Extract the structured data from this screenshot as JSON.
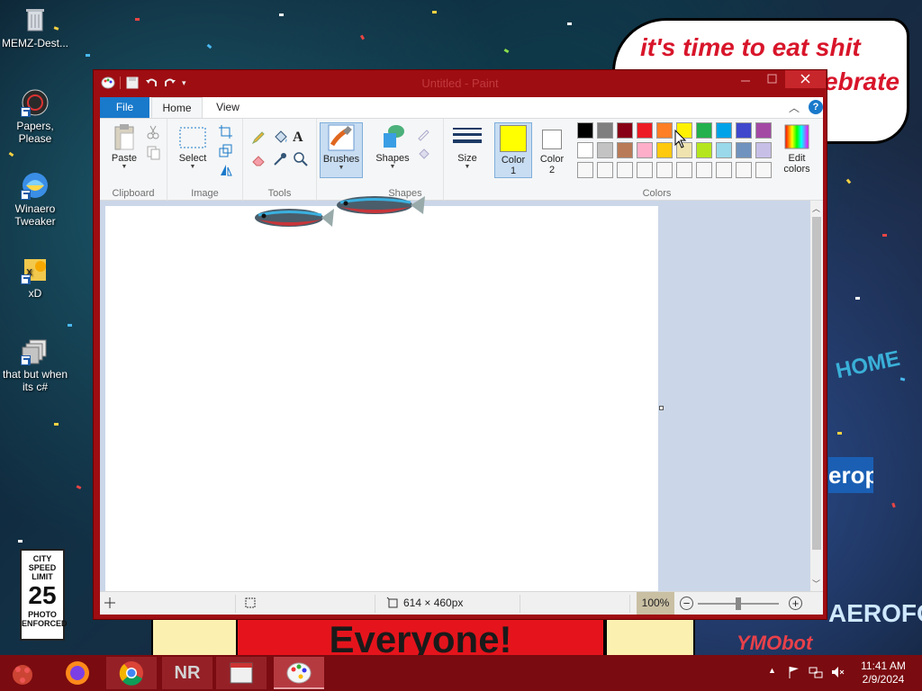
{
  "desktop": {
    "icons": [
      {
        "label": "MEMZ-Dest..."
      },
      {
        "label": "Papers, Please"
      },
      {
        "label": "Winaero Tweaker"
      },
      {
        "label": "xD"
      },
      {
        "label": "that but when its c#"
      }
    ],
    "bubble": {
      "line1": "it's time to eat shit",
      "line2": "ebrate"
    },
    "banner": "Everyone!",
    "sign": {
      "line1": "CITY",
      "line2": "SPEED",
      "line3": "LIMIT",
      "value": "25",
      "line4": "PHOTO",
      "line5": "ENFORCED"
    },
    "watermark": "YMObot",
    "building_sign": "AEROFOS",
    "building_sign2": "erop",
    "home_sign": "HOME"
  },
  "window": {
    "title": "Untitled - Paint",
    "tabs": {
      "file": "File",
      "home": "Home",
      "view": "View"
    },
    "help": "?",
    "ribbon": {
      "clipboard": {
        "label": "Clipboard",
        "paste": "Paste"
      },
      "image": {
        "label": "Image",
        "select": "Select"
      },
      "tools": {
        "label": "Tools",
        "text_glyph": "A"
      },
      "brushes": {
        "label": "Brushes"
      },
      "shapes": {
        "label": "Shapes",
        "group": "Shapes"
      },
      "size": {
        "label": "Size"
      },
      "color1": {
        "line1": "Color",
        "line2": "1",
        "value": "#ffff00"
      },
      "color2": {
        "line1": "Color",
        "line2": "2",
        "value": "#ffffff"
      },
      "colors": {
        "label": "Colors"
      },
      "edit_colors": {
        "line1": "Edit",
        "line2": "colors"
      }
    },
    "palette_row1": [
      "#000000",
      "#7f7f7f",
      "#880015",
      "#ed1c24",
      "#ff7f27",
      "#fff200",
      "#22b14c",
      "#00a2e8",
      "#3f48cc",
      "#a349a4"
    ],
    "palette_row2": [
      "#ffffff",
      "#c3c3c3",
      "#b97a57",
      "#ffaec9",
      "#ffc90e",
      "#efe4b0",
      "#b5e61d",
      "#99d9ea",
      "#7092be",
      "#c8bfe7"
    ],
    "palette_row3_count": 10,
    "status": {
      "dimensions": "614 × 460px",
      "zoom": "100%"
    }
  },
  "taskbar": {
    "items": [
      {
        "name": "firefox"
      },
      {
        "name": "chrome"
      },
      {
        "name": "nr",
        "label": "NR"
      },
      {
        "name": "app"
      },
      {
        "name": "paint"
      }
    ],
    "time": "11:41 AM",
    "date": "2/9/2024"
  }
}
